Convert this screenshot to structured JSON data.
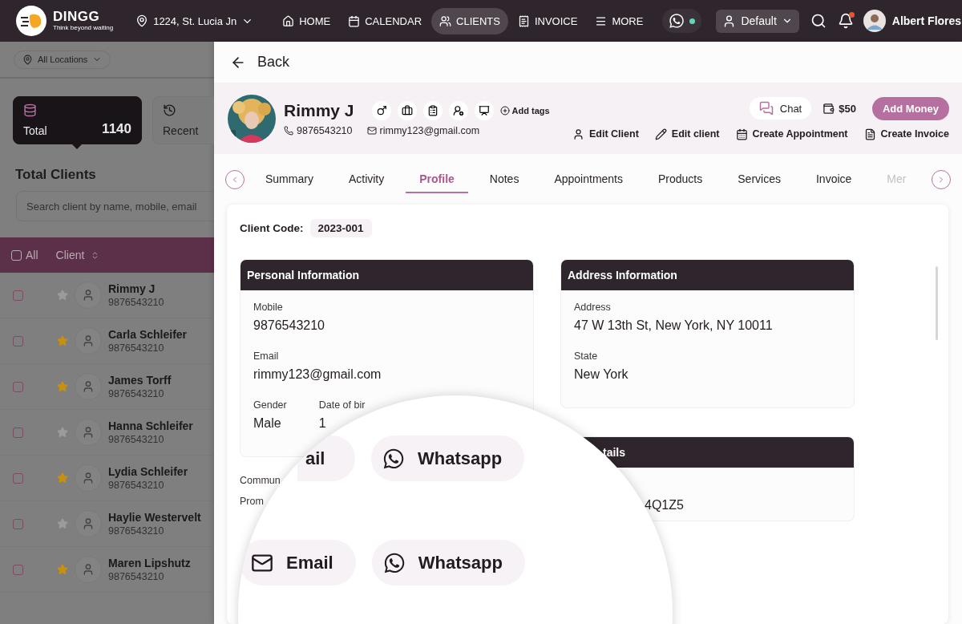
{
  "nav": {
    "brand": "DINGG",
    "tagline": "Think beyond waiting",
    "location": "1224, St. Lucia Jn",
    "items": [
      {
        "label": "HOME",
        "selected": false
      },
      {
        "label": "CALENDAR",
        "selected": false
      },
      {
        "label": "CLIENTS",
        "selected": true
      },
      {
        "label": "INVOICE",
        "selected": false
      },
      {
        "label": "MORE",
        "selected": false
      }
    ],
    "chat_online": true,
    "profile": "Default",
    "has_notifications": true,
    "user": "Albert Flores"
  },
  "sidebar": {
    "location_filter": "All Locations",
    "stats": [
      {
        "kind": "total",
        "label": "Total",
        "count": "1140",
        "selected": true
      },
      {
        "kind": "recent",
        "label": "Recent",
        "selected": false
      }
    ],
    "title": "Total Clients",
    "search": {
      "placeholder": "Search client by name, mobile, email"
    },
    "table": {
      "select_all": {
        "label": "All",
        "checked": false
      },
      "column": "Client",
      "rows": [
        {
          "name": "Rimmy J",
          "phone": "9876543210",
          "checked": false,
          "favorite": false
        },
        {
          "name": "Carla Schleifer",
          "phone": "9876543210",
          "checked": false,
          "favorite": true
        },
        {
          "name": "James Torff",
          "phone": "9876543210",
          "checked": false,
          "favorite": true
        },
        {
          "name": "Hanna Schleifer",
          "phone": "9876543210",
          "checked": false,
          "favorite": false
        },
        {
          "name": "Lydia Schleifer",
          "phone": "9876543210",
          "checked": false,
          "favorite": true
        },
        {
          "name": "Haylie Westervelt",
          "phone": "9876543210",
          "checked": false,
          "favorite": false
        },
        {
          "name": "Maren Lipshutz",
          "phone": "9876543210",
          "checked": false,
          "favorite": true
        }
      ]
    }
  },
  "drawer": {
    "back": "Back",
    "client": {
      "name": "Rimmy J",
      "phone": "9876543210",
      "email": "rimmy123@gmail.com",
      "add_tags": "Add tags"
    },
    "chat": "Chat",
    "wallet": "$50",
    "add_money": "Add Money",
    "actions": [
      "Edit Client",
      "Edit client",
      "Create Appointment",
      "Create Invoice"
    ],
    "tabs": [
      {
        "label": "Summary",
        "selected": false
      },
      {
        "label": "Activity",
        "selected": false
      },
      {
        "label": "Profile",
        "selected": true
      },
      {
        "label": "Notes",
        "selected": false
      },
      {
        "label": "Appointments",
        "selected": false
      },
      {
        "label": "Products",
        "selected": false
      },
      {
        "label": "Services",
        "selected": false
      },
      {
        "label": "Invoice",
        "selected": false
      },
      {
        "label": "Mer",
        "selected": false
      }
    ],
    "client_code": {
      "label": "Client Code:",
      "value": "2023-001"
    },
    "personal": {
      "title": "Personal Information",
      "fields": [
        {
          "label": "Mobile",
          "value": "9876543210"
        },
        {
          "label": "Email",
          "value": "rimmy123@gmail.com"
        }
      ],
      "pair": [
        {
          "label": "Gender",
          "value": "Male"
        },
        {
          "label": "Date of bir",
          "value": "1"
        }
      ]
    },
    "below": [
      "Commun",
      "Prom"
    ],
    "address": {
      "title": "Address Information",
      "fields": [
        {
          "label": "Address",
          "value": "47 W 13th St, New York, NY 10011"
        },
        {
          "label": "State",
          "value": "New York"
        }
      ]
    },
    "details": {
      "title": "tails",
      "value": "4Q1Z5"
    }
  },
  "magnifier": {
    "rows": [
      [
        {
          "label": "ail",
          "kind": "cut"
        },
        {
          "label": "Whatsapp",
          "kind": "chat"
        }
      ],
      [
        {
          "label": "Email",
          "kind": "mail"
        },
        {
          "label": "Whatsapp",
          "kind": "chat"
        }
      ]
    ]
  }
}
